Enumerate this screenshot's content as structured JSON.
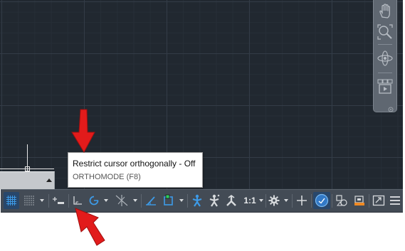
{
  "tooltip": {
    "title": "Restrict cursor orthogonally - Off",
    "command": "ORTHOMODE (F8)"
  },
  "statusbar": {
    "scale_label": "1:1",
    "items": [
      {
        "name": "grid-display",
        "icon": "grid-icon",
        "active": true
      },
      {
        "name": "snap-mode",
        "icon": "snap-dots-icon",
        "active": false
      },
      {
        "name": "infer-constraints",
        "icon": "constraint-plus-icon",
        "active": false
      },
      {
        "name": "ortho-mode",
        "icon": "ortho-icon",
        "active": false
      },
      {
        "name": "polar-tracking",
        "icon": "polar-icon",
        "active": true
      },
      {
        "name": "isodraft",
        "icon": "isodraft-icon",
        "active": false
      },
      {
        "name": "object-snap-tracking",
        "icon": "osnap-tracking-icon",
        "active": true
      },
      {
        "name": "object-snap",
        "icon": "osnap-icon",
        "active": true
      },
      {
        "name": "annotation-visibility",
        "icon": "annotation-figure-icon",
        "active": true
      },
      {
        "name": "auto-scale",
        "icon": "autoscale-figure-icon",
        "active": false
      },
      {
        "name": "annotation-scale",
        "icon": "annotation-scale-figure-icon",
        "active": false
      },
      {
        "name": "workspace-switching",
        "icon": "gear-icon",
        "active": false
      },
      {
        "name": "annotation-monitor",
        "icon": "plus-icon",
        "active": false
      },
      {
        "name": "units",
        "icon": "units-circle-icon",
        "active": true
      },
      {
        "name": "quick-properties",
        "icon": "quick-properties-icon",
        "active": false
      },
      {
        "name": "lock-ui",
        "icon": "lock-ui-icon",
        "active": false
      },
      {
        "name": "clean-screen",
        "icon": "clean-screen-icon",
        "active": false
      },
      {
        "name": "customization",
        "icon": "hamburger-menu-icon",
        "active": false
      }
    ]
  },
  "navbar": {
    "items": [
      "pan-hand-icon",
      "zoom-extents-icon",
      "orbit-icon",
      "showmotion-icon"
    ]
  },
  "colors": {
    "canvas": "#212830",
    "statusbar": "#434b55",
    "accent_blue": "#3d9be8",
    "annotation_red": "#e21b1b"
  }
}
